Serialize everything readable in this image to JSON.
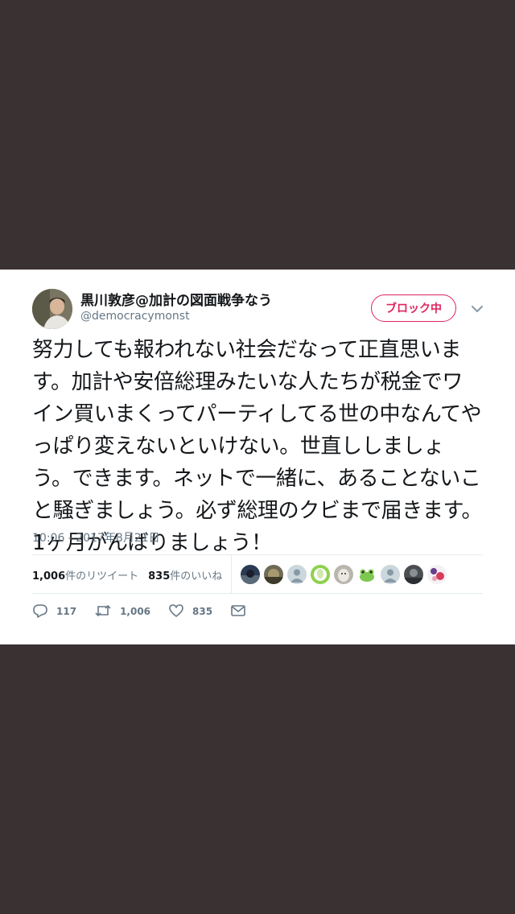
{
  "tweet": {
    "author": {
      "name": "黒川敦彦@加計の図面戦争なう",
      "handle": "@democracymonst",
      "avatar_icon": "user-avatar-photo"
    },
    "block_button_label": "ブロック中",
    "menu_icon": "chevron-down-icon",
    "text": "努力しても報われない社会だなって正直思います。加計や安倍総理みたいな人たちが税金でワイン買いまくってパーティしてる世の中なんてやっぱり変えないといけない。世直ししましょう。できます。ネットで一緒に、あることないこと騒ぎましょう。必ず総理のクビまで届きます。1ヶ月がんばりましょう！",
    "timestamp": "10:06 - 2017年8月21日",
    "stats": {
      "retweets_count": "1,006",
      "retweets_label": "件のリツイート",
      "likes_count": "835",
      "likes_label": "件のいいね"
    },
    "likers": [
      "photo",
      "photo",
      "default",
      "green",
      "dog",
      "frog",
      "default",
      "photo",
      "pattern"
    ],
    "actions": {
      "reply_count": "117",
      "retweet_count": "1,006",
      "like_count": "835"
    }
  },
  "colors": {
    "background": "#3a3133",
    "accent": "#e0245e",
    "muted": "#657786"
  }
}
